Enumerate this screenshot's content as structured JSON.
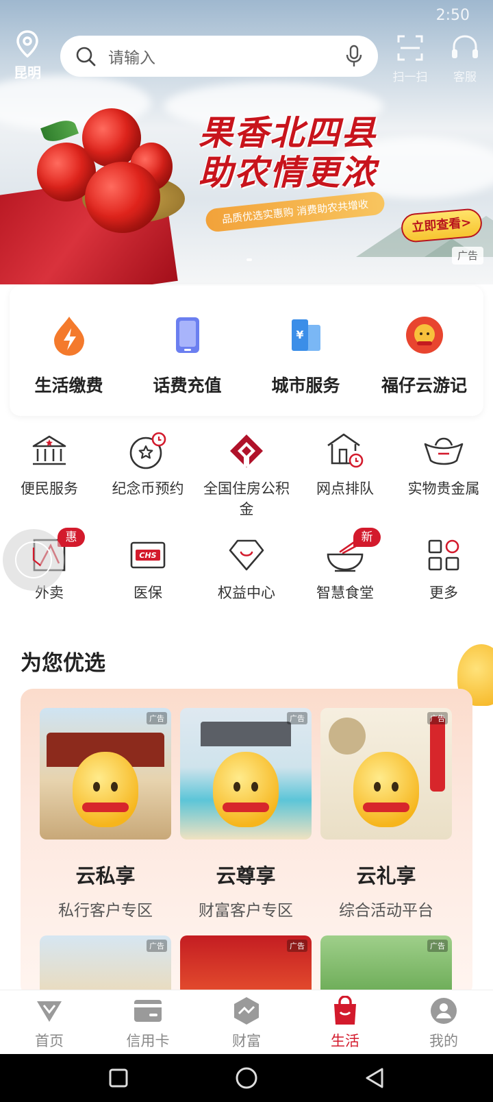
{
  "status": {
    "time": "2:50"
  },
  "header": {
    "location_label": "昆明",
    "search_placeholder": "请输入",
    "scan_label": "扫一扫",
    "service_label": "客服"
  },
  "banner": {
    "slogan_line1": "果香北四县",
    "slogan_line2": "助农情更浓",
    "subtitle": "品质优选实惠购 消费助农共增收",
    "cta_label": "立即查看>",
    "ad_tag": "广告"
  },
  "quick_actions": [
    {
      "label": "生活缴费",
      "icon": "bolt-drop-icon",
      "color": "#f47a2c"
    },
    {
      "label": "话费充值",
      "icon": "phone-icon",
      "color": "#6b7ff0"
    },
    {
      "label": "城市服务",
      "icon": "building-icon",
      "color": "#3b8ee8"
    },
    {
      "label": "福仔云游记",
      "icon": "mascot-icon",
      "color": "#e8452f"
    }
  ],
  "services_row1": [
    {
      "label": "便民服务",
      "icon": "civic-building-icon"
    },
    {
      "label": "纪念币预约",
      "icon": "coin-clock-icon"
    },
    {
      "label": "全国住房公积金",
      "icon": "housing-fund-icon"
    },
    {
      "label": "网点排队",
      "icon": "branch-queue-icon"
    },
    {
      "label": "实物贵金属",
      "icon": "gold-ingot-icon"
    }
  ],
  "services_row2": [
    {
      "label": "外卖",
      "icon": "takeout-icon",
      "badge": "惠"
    },
    {
      "label": "医保",
      "icon": "chs-card-icon"
    },
    {
      "label": "权益中心",
      "icon": "diamond-icon"
    },
    {
      "label": "智慧食堂",
      "icon": "bowl-icon",
      "badge": "新"
    },
    {
      "label": "更多",
      "icon": "grid-more-icon"
    }
  ],
  "recommend": {
    "title": "为您优选",
    "cards": [
      {
        "title": "云私享",
        "subtitle": "私行客户专区",
        "ad": "广告"
      },
      {
        "title": "云尊享",
        "subtitle": "财富客户专区",
        "ad": "广告"
      },
      {
        "title": "云礼享",
        "subtitle": "综合活动平台",
        "ad": "广告"
      }
    ],
    "more_ads": [
      "广告",
      "广告",
      "广告"
    ]
  },
  "tabs": [
    {
      "label": "首页",
      "icon": "home-icon",
      "active": false
    },
    {
      "label": "信用卡",
      "icon": "credit-card-icon",
      "active": false
    },
    {
      "label": "财富",
      "icon": "wealth-icon",
      "active": false
    },
    {
      "label": "生活",
      "icon": "shopping-bag-icon",
      "active": true
    },
    {
      "label": "我的",
      "icon": "profile-icon",
      "active": false
    }
  ],
  "colors": {
    "brand_red": "#d31a2c",
    "tab_inactive": "#888888"
  }
}
